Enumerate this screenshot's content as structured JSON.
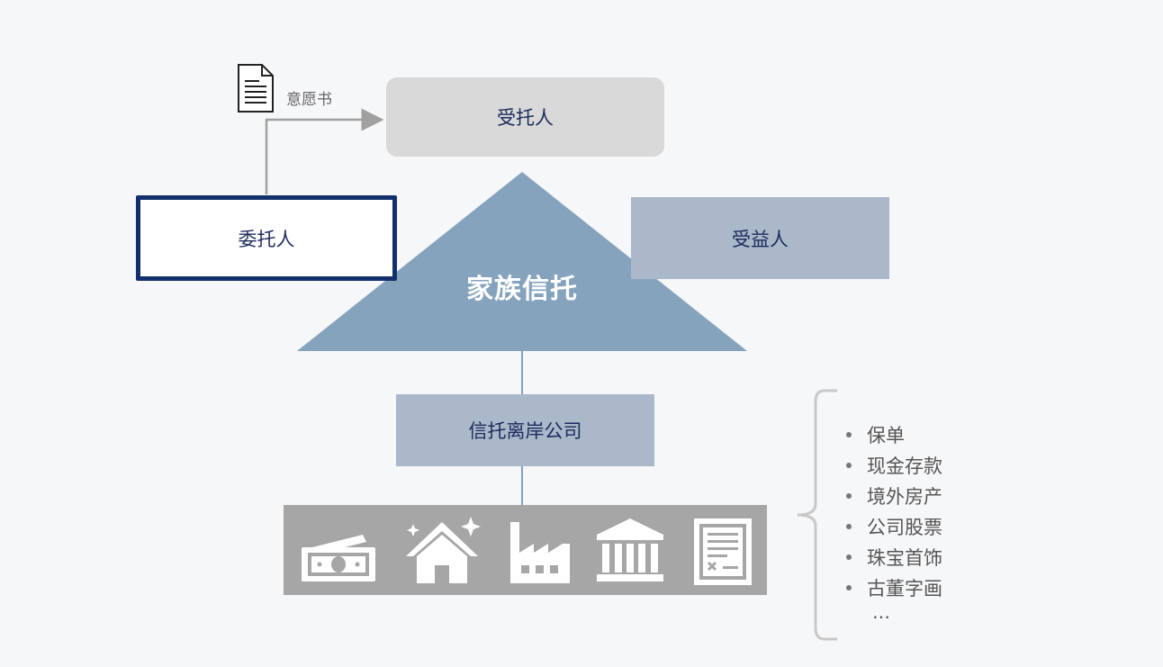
{
  "nodes": {
    "trustee": "受托人",
    "settlor": "委托人",
    "beneficiary": "受益人",
    "family_trust": "家族信托",
    "offshore_company": "信托离岸公司"
  },
  "document_label": "意愿书",
  "asset_icons": [
    "cash-icon",
    "house-icon",
    "factory-icon",
    "bank-icon",
    "document-icon"
  ],
  "asset_list": [
    "保单",
    "现金存款",
    "境外房产",
    "公司股票",
    "珠宝首饰",
    "古董字画"
  ],
  "asset_list_more": "…",
  "colors": {
    "background": "#f6f7f9",
    "triangle": "#86a3be",
    "settlor_border": "#12306e",
    "beneficiary_fill": "#aab8ca",
    "trustee_fill": "#d9d9d9",
    "asset_bar": "#a6a6a6",
    "text": "#1c2a5c"
  }
}
